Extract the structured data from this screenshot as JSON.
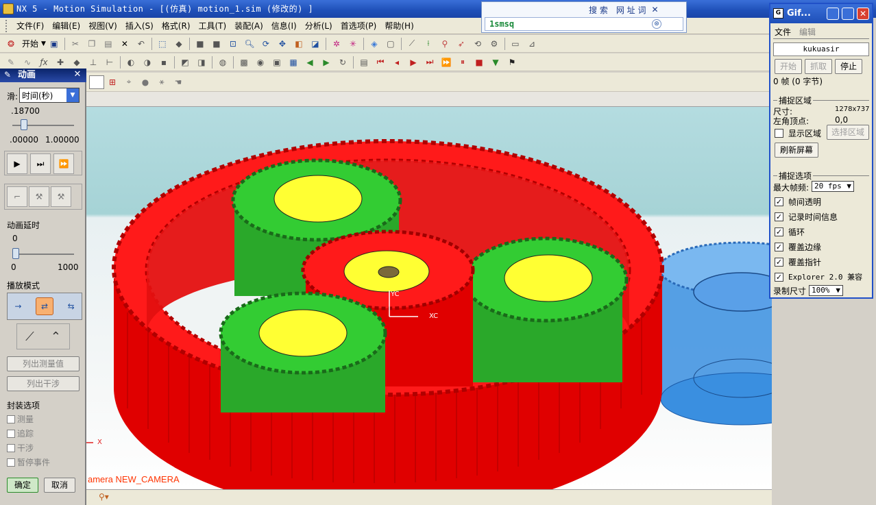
{
  "title": "NX 5 - Motion Simulation - [(仿真) motion_1.sim  (修改的) ]",
  "menu": [
    "文件(F)",
    "编辑(E)",
    "视图(V)",
    "插入(S)",
    "格式(R)",
    "工具(T)",
    "装配(A)",
    "信息(I)",
    "分析(L)",
    "首选项(P)",
    "帮助(H)"
  ],
  "toolbar": {
    "start_label": "开始"
  },
  "search": {
    "tab_search": "搜 索",
    "tab_url": "网 址 词",
    "query": "1smsq"
  },
  "animation_panel": {
    "title": "动画",
    "slider_label": "滑:",
    "slider_mode": "时间(秒)",
    "current_value": ".18700",
    "min_value": ".00000",
    "max_value": "1.00000",
    "time_fraction": 0.187,
    "delay_label": "动画延时",
    "delay_value": "0",
    "delay_min": "0",
    "delay_max": "1000",
    "play_mode_label": "播放模式",
    "list_measure": "列出测量值",
    "list_interference": "列出干涉",
    "package_label": "封装选项",
    "options": [
      "测量",
      "追踪",
      "干涉",
      "暂停事件"
    ],
    "ok": "确定",
    "cancel": "取消"
  },
  "viewport": {
    "camera_label": "amera NEW_CAMERA",
    "axis_yc": "YC",
    "axis_xc": "XC",
    "axis_x": "X",
    "colors": {
      "ring_gear": "#ff0000",
      "sun_gear": "#ff0000",
      "planet_gear": "#33cc33",
      "hub": "#ffff33",
      "external_gear": "#3a8fe0"
    }
  },
  "gif_window": {
    "title": "Gif...",
    "menu_file": "文件",
    "menu_edit": "编辑",
    "author": "kukuasir",
    "btn_start": "开始",
    "btn_capture": "抓取",
    "btn_stop": "停止",
    "frames": "0 帧 (0 字节)",
    "capture_area_label": "捕捉区域",
    "size_label": "尺寸:",
    "size_value": "1278x737",
    "origin_label": "左角顶点:",
    "origin_value": "0,0",
    "show_area": "显示区域",
    "select_area": "选择区域",
    "refresh": "刷新屏幕",
    "capture_options_label": "捕捉选项",
    "max_fps_label": "最大帧频:",
    "max_fps_value": "20 fps",
    "options": [
      {
        "label": "帧间透明",
        "checked": true
      },
      {
        "label": "记录时间信息",
        "checked": true
      },
      {
        "label": "循环",
        "checked": true
      },
      {
        "label": "覆盖边缘",
        "checked": true
      },
      {
        "label": "覆盖指针",
        "checked": true
      },
      {
        "label": "Explorer 2.0 兼容",
        "checked": true
      }
    ],
    "record_size_label": "录制尺寸",
    "record_size_value": "100%"
  }
}
